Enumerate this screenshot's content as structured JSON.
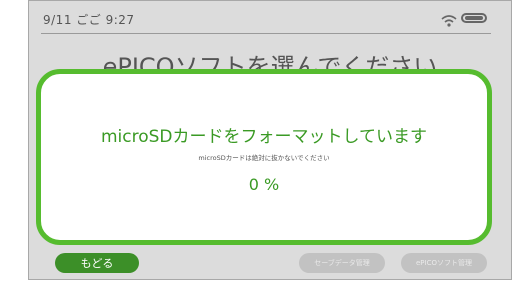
{
  "status_bar": {
    "time": "9/11 ごご 9:27",
    "icons": [
      "wifi-icon",
      "battery-icon"
    ]
  },
  "background": {
    "title": "ePICOソフトを選んでください",
    "back_button": "もどる",
    "save_data_button": "セーブデータ管理",
    "soft_list_button": "ePICOソフト管理"
  },
  "dialog": {
    "title": "microSDカードをフォーマットしています",
    "subtitle": "microSDカードは絶対に抜かないでください",
    "progress_text": "0 %",
    "progress_value": 0
  },
  "colors": {
    "accent_green": "#56bc2f",
    "text_green": "#3a9a24",
    "button_green": "#3c8f28",
    "screen_gray": "#dcdcdc"
  }
}
